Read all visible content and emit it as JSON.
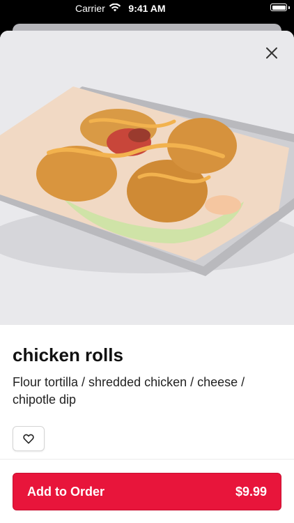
{
  "status_bar": {
    "carrier": "Carrier",
    "time": "9:41 AM"
  },
  "product": {
    "image_alt_icon": "chicken-rolls-photo",
    "title": "chicken rolls",
    "description": "Flour tortilla / shredded chicken / cheese / chipotle dip",
    "price": "$9.99"
  },
  "actions": {
    "close_icon": "close-icon",
    "favorite_icon": "heart-icon",
    "add_label": "Add to Order"
  },
  "colors": {
    "accent": "#e8153b",
    "hero_bg": "#e9e9ec"
  }
}
